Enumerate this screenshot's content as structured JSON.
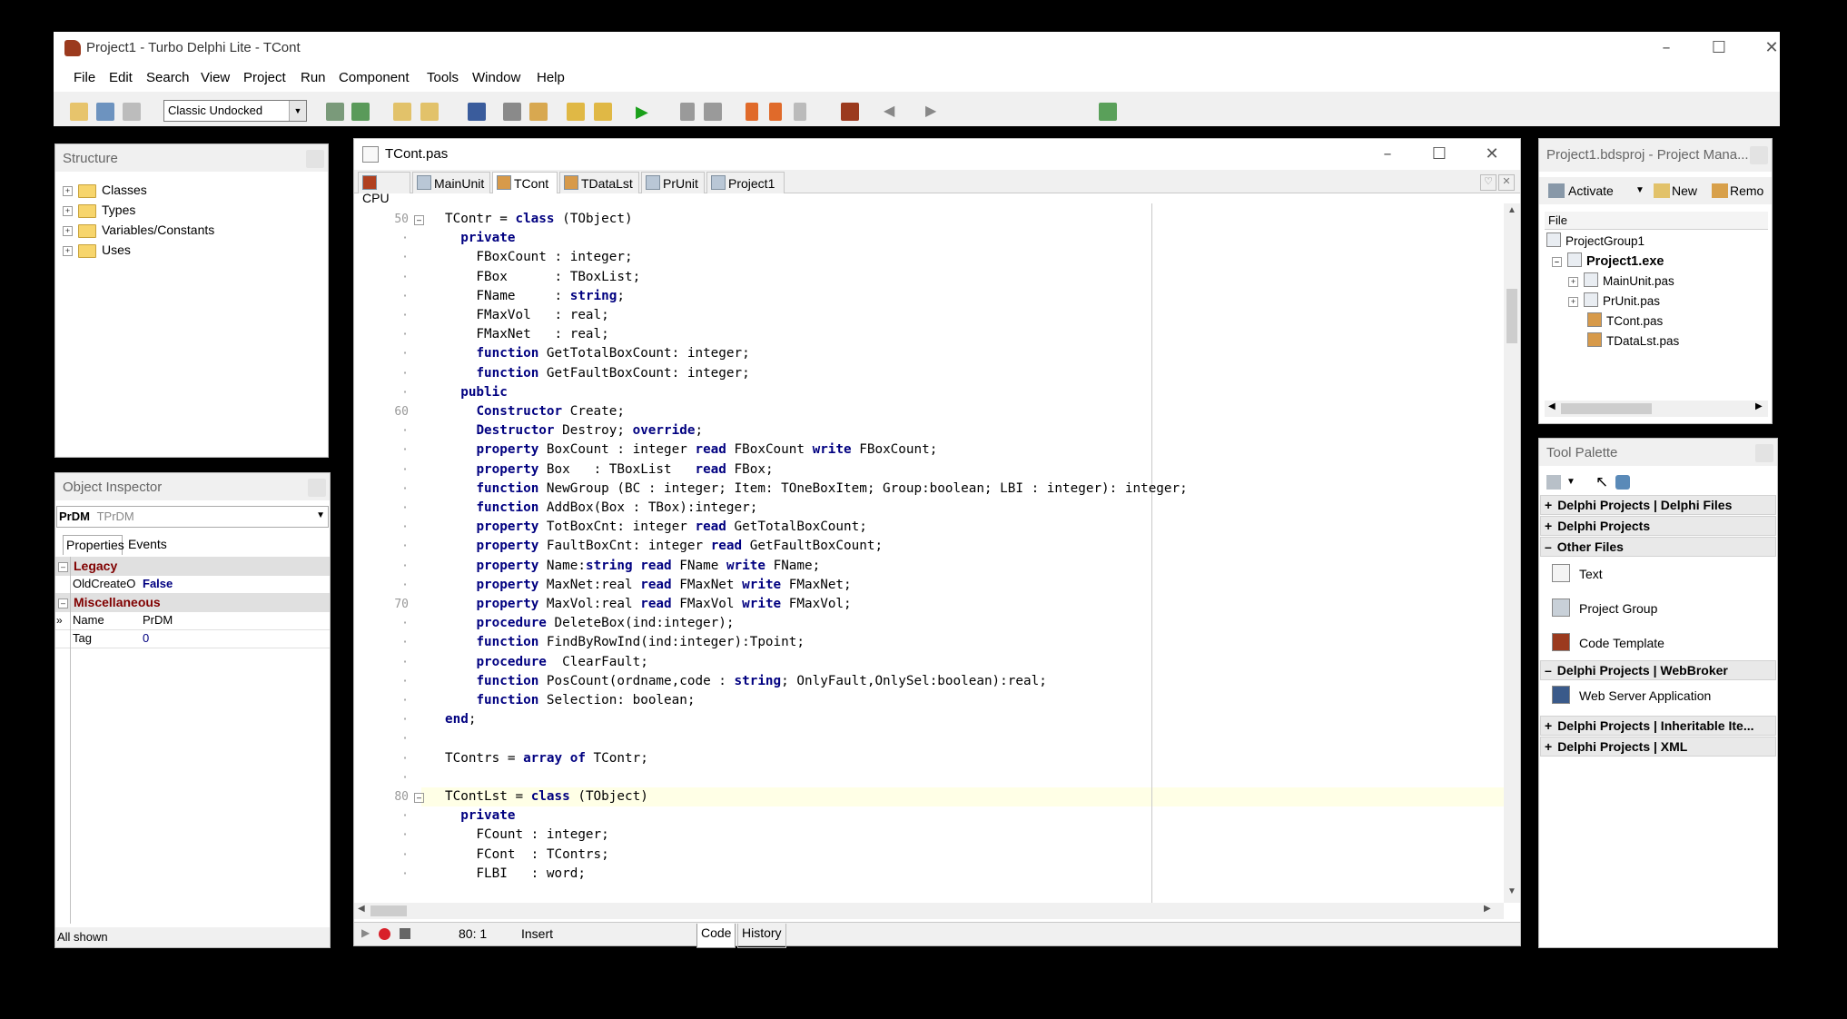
{
  "window": {
    "title": "Project1 - Turbo Delphi Lite - TCont",
    "menu": [
      "File",
      "Edit",
      "Search",
      "View",
      "Project",
      "Run",
      "Component",
      "Tools",
      "Window",
      "Help"
    ],
    "layout_combo": "Classic Undocked"
  },
  "structure": {
    "title": "Structure",
    "items": [
      "Classes",
      "Types",
      "Variables/Constants",
      "Uses"
    ]
  },
  "object_inspector": {
    "title": "Object Inspector",
    "selected_name": "PrDM",
    "selected_type": "TPrDM",
    "tabs": [
      "Properties",
      "Events"
    ],
    "groups": [
      {
        "label": "Legacy",
        "rows": [
          {
            "name": "OldCreateO",
            "value": "False"
          }
        ]
      },
      {
        "label": "Miscellaneous",
        "rows": [
          {
            "name": "Name",
            "value": "PrDM"
          },
          {
            "name": "Tag",
            "value": "0"
          }
        ]
      }
    ],
    "status": "All shown"
  },
  "editor": {
    "title": "TCont.pas",
    "tabs": [
      "CPU",
      "MainUnit",
      "TCont",
      "TDataLst",
      "PrUnit",
      "Project1"
    ],
    "active_tab": "TCont",
    "line_numbers": [
      "50",
      "60",
      "70",
      "80"
    ],
    "status": {
      "position": "80:  1",
      "mode": "Insert",
      "views": [
        "Code",
        "History"
      ]
    }
  },
  "code_lines": [
    "TContr = class (TObject)",
    "  private",
    "    FBoxCount : integer;",
    "    FBox      : TBoxList;",
    "    FName     : string;",
    "    FMaxVol   : real;",
    "    FMaxNet   : real;",
    "    function GetTotalBoxCount: integer;",
    "    function GetFaultBoxCount: integer;",
    "  public",
    "    Constructor Create;",
    "    Destructor Destroy; override;",
    "    property BoxCount : integer read FBoxCount write FBoxCount;",
    "    property Box   : TBoxList   read FBox;",
    "    function NewGroup (BC : integer; Item: TOneBoxItem; Group:boolean; LBI : integer): integer;",
    "    function AddBox(Box : TBox):integer;",
    "    property TotBoxCnt: integer read GetTotalBoxCount;",
    "    property FaultBoxCnt: integer read GetFaultBoxCount;",
    "    property Name:string read FName write FName;",
    "    property MaxNet:real read FMaxNet write FMaxNet;",
    "    property MaxVol:real read FMaxVol write FMaxVol;",
    "    procedure DeleteBox(ind:integer);",
    "    function FindByRowInd(ind:integer):Tpoint;",
    "    procedure  ClearFault;",
    "    function PosCount(ordname,code : string; OnlyFault,OnlySel:boolean):real;",
    "    function Selection: boolean;",
    "end;",
    "",
    "TContrs = array of TContr;",
    "",
    "TContLst = class (TObject)",
    "  private",
    "    FCount : integer;",
    "    FCont  : TContrs;",
    "    FLBI   : word;"
  ],
  "project_manager": {
    "title": "Project1.bdsproj - Project Mana...",
    "toolbar": [
      "Activate",
      "New",
      "Remo"
    ],
    "column": "File",
    "items": [
      "ProjectGroup1",
      "Project1.exe",
      "MainUnit.pas",
      "PrUnit.pas",
      "TCont.pas",
      "TDataLst.pas"
    ]
  },
  "tool_palette": {
    "title": "Tool Palette",
    "categories": [
      {
        "label": "Delphi Projects | Delphi Files",
        "expanded": false
      },
      {
        "label": "Delphi Projects",
        "expanded": false
      },
      {
        "label": "Other Files",
        "expanded": true,
        "items": [
          "Text",
          "Project Group",
          "Code Template"
        ]
      },
      {
        "label": "Delphi Projects | WebBroker",
        "expanded": true,
        "items": [
          "Web Server Application"
        ]
      },
      {
        "label": "Delphi Projects | Inheritable Ite...",
        "expanded": false
      },
      {
        "label": "Delphi Projects | XML",
        "expanded": false
      }
    ]
  },
  "colors": {
    "keyword": "#000080",
    "legacy_group": "#800000",
    "current_line": "#ffffe6"
  }
}
